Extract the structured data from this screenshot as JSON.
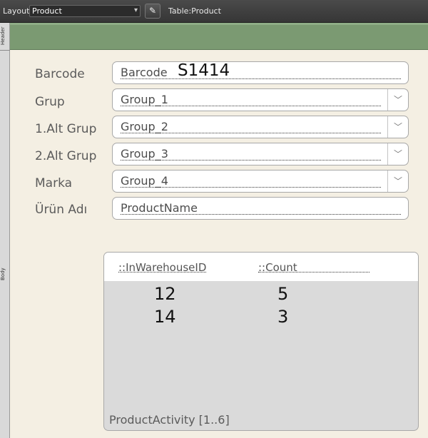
{
  "toolbar": {
    "layout_label": "Layout:",
    "layout_value": "Product",
    "table_label": "Table:",
    "table_value": "Product"
  },
  "parts": {
    "header": "Header",
    "body": "Body"
  },
  "fields": [
    {
      "label": "Barcode",
      "placeholder": "Barcode",
      "value": "S1414",
      "dropdown": false
    },
    {
      "label": "Grup",
      "placeholder": "Group_1",
      "value": "",
      "dropdown": true
    },
    {
      "label": "1.Alt Grup",
      "placeholder": "Group_2",
      "value": "",
      "dropdown": true
    },
    {
      "label": "2.Alt Grup",
      "placeholder": "Group_3",
      "value": "",
      "dropdown": true
    },
    {
      "label": "Marka",
      "placeholder": "Group_4",
      "value": "",
      "dropdown": true
    },
    {
      "label": "Ürün Adı",
      "placeholder": "ProductName",
      "value": "",
      "dropdown": false
    }
  ],
  "portal": {
    "columns": [
      "::InWarehouseID",
      "::Count"
    ],
    "rows": [
      [
        "12",
        "5"
      ],
      [
        "14",
        "3"
      ]
    ],
    "footer": "ProductActivity [1..6]"
  },
  "colors": {
    "toolbar": "#3d3d3d",
    "header_band": "#7b9a72",
    "body_bg": "#f4efe3",
    "portal_bg": "#dadada"
  },
  "icons": {
    "edit_button": "pencil-icon",
    "dropdown": "chevron-down-icon"
  }
}
